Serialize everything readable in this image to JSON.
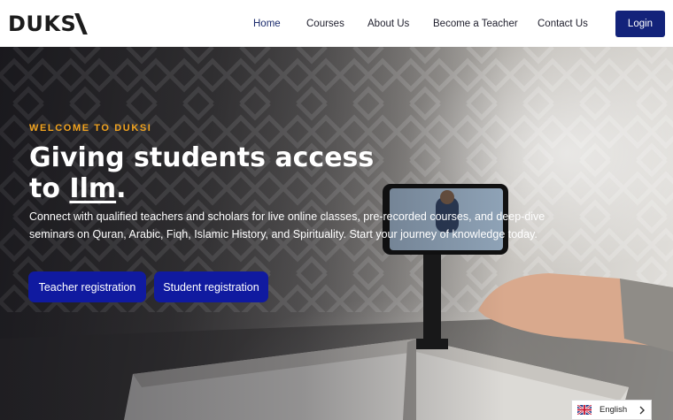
{
  "brand": {
    "logo_text": "DUKS"
  },
  "nav": {
    "items": [
      {
        "label": "Home",
        "active": true
      },
      {
        "label": "Courses",
        "active": false
      },
      {
        "label": "About Us",
        "active": false
      },
      {
        "label": "Become a Teacher",
        "active": false
      },
      {
        "label": "Contact Us",
        "active": false
      }
    ],
    "login_label": "Login"
  },
  "hero": {
    "kicker": "WELCOME TO DUKSI",
    "headline_line1": "Giving students access",
    "headline_to": "to ",
    "headline_ilm": "Ilm",
    "headline_end": ".",
    "lead": "Connect with qualified teachers and scholars for live online classes, pre-recorded courses, and deep-dive seminars on Quran, Arabic, Fiqh, Islamic History, and Spirituality. Start your journey of knowledge today.",
    "buttons": {
      "teacher": "Teacher registration",
      "student": "Student registration"
    }
  },
  "language": {
    "label": "English",
    "flag_icon": "uk-flag-icon"
  },
  "colors": {
    "primary": "#13237a",
    "cta": "#101aa0",
    "accent": "#f2a41f",
    "nav_text": "#1e1e2c"
  }
}
